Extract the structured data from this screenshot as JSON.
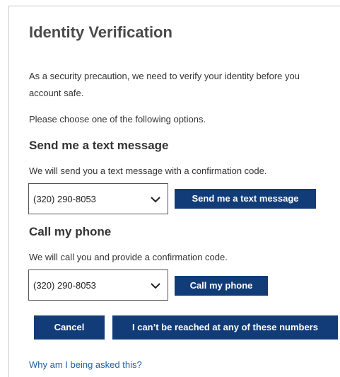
{
  "page": {
    "title": "Identity Verification",
    "intro_line1": "As a security precaution, we need to verify your identity before you",
    "intro_line2": "account safe.",
    "choose_text": "Please choose one of the following options."
  },
  "text_option": {
    "heading": "Send me a text message",
    "description": "We will send you a text message with a confirmation code.",
    "selected_number": "(320) 290-8053",
    "button_label": "Send me a text message"
  },
  "call_option": {
    "heading": "Call my phone",
    "description": "We will call you and provide a confirmation code.",
    "selected_number": "(320) 290-8053",
    "button_label": "Call my phone"
  },
  "actions": {
    "cancel_label": "Cancel",
    "unreachable_label": "I can’t be reached at any of these numbers"
  },
  "help_link": "Why am I being asked this?",
  "colors": {
    "button_bg": "#123c78",
    "link": "#1f5ea8"
  },
  "icons": {
    "dropdown": "chevron-down-icon"
  }
}
